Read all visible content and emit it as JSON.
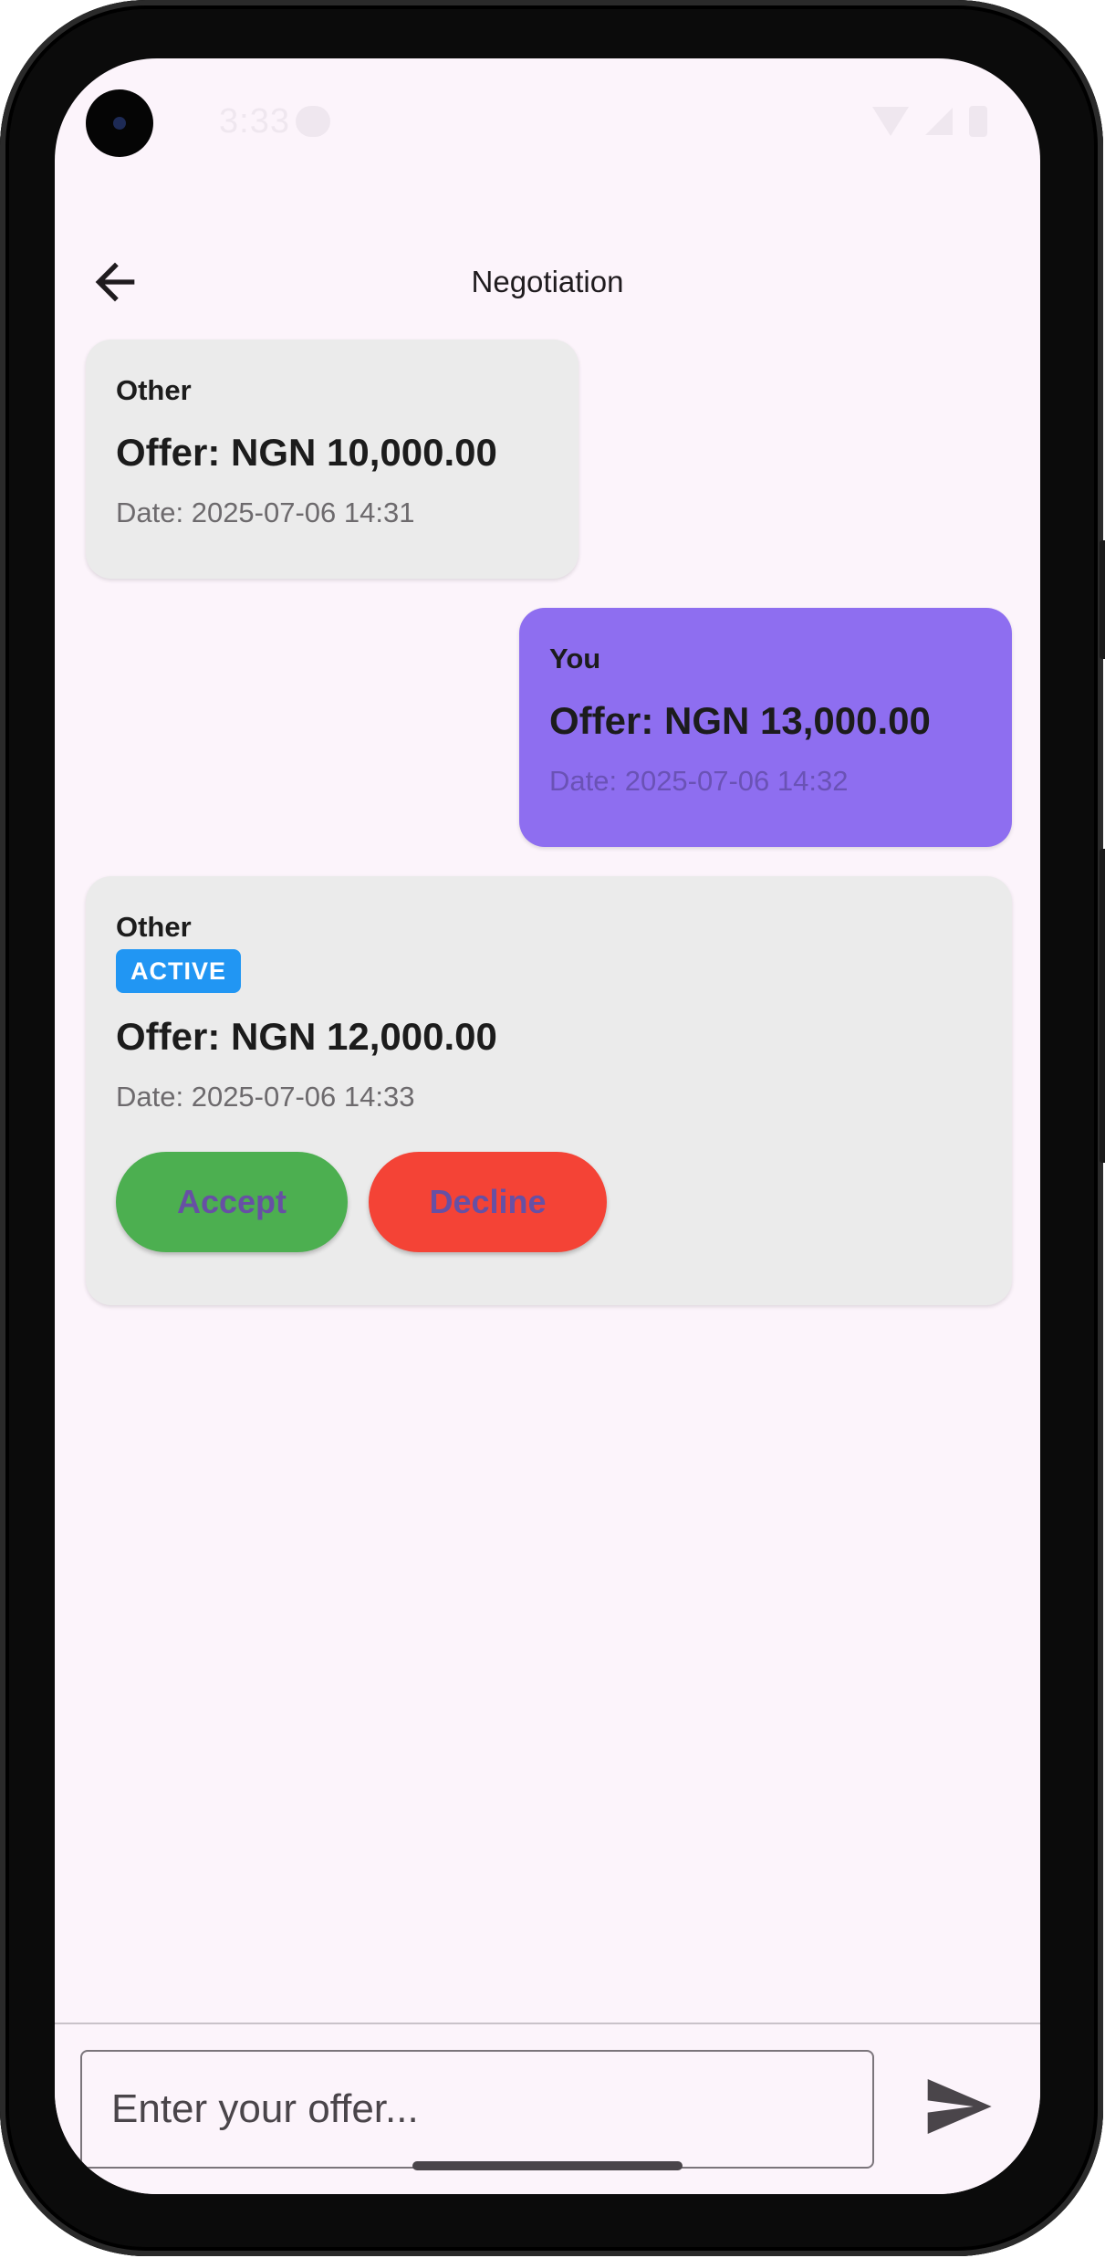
{
  "status_bar": {
    "time": "3:33"
  },
  "app_bar": {
    "title": "Negotiation"
  },
  "messages": [
    {
      "sender": "Other",
      "offer": "Offer: NGN 10,000.00",
      "date": "Date: 2025-07-06 14:31"
    },
    {
      "sender": "You",
      "offer": "Offer: NGN 13,000.00",
      "date": "Date: 2025-07-06 14:32"
    },
    {
      "sender": "Other",
      "badge": "ACTIVE",
      "offer": "Offer: NGN 12,000.00",
      "date": "Date: 2025-07-06 14:33",
      "accept_label": "Accept",
      "decline_label": "Decline"
    }
  ],
  "input": {
    "placeholder": "Enter your offer...",
    "value": ""
  },
  "icons": {
    "back": "arrow-back-icon",
    "send": "send-icon"
  },
  "colors": {
    "background": "#fcf4fb",
    "other_bubble": "#ebebeb",
    "you_bubble": "#8e6ef0",
    "badge": "#2196f3",
    "accept": "#4caf50",
    "decline": "#f44336",
    "button_text": "#6750a4"
  }
}
